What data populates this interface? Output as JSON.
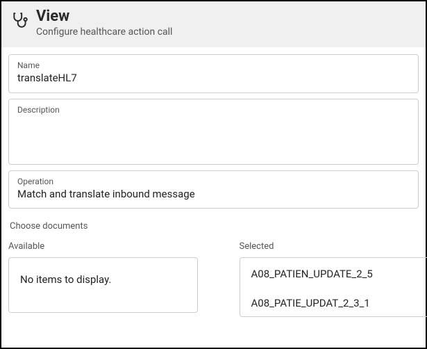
{
  "header": {
    "title": "View",
    "subtitle": "Configure healthcare action call"
  },
  "fields": {
    "name_label": "Name",
    "name_value": "translateHL7",
    "description_label": "Description",
    "description_value": "",
    "operation_label": "Operation",
    "operation_value": "Match and translate inbound message"
  },
  "documents": {
    "section_label": "Choose documents",
    "available_label": "Available",
    "available_empty": "No items to display.",
    "selected_label": "Selected",
    "selected_items": [
      "A08_PATIEN_UPDATE_2_5",
      "A08_PATIE_UPDAT_2_3_1"
    ]
  }
}
